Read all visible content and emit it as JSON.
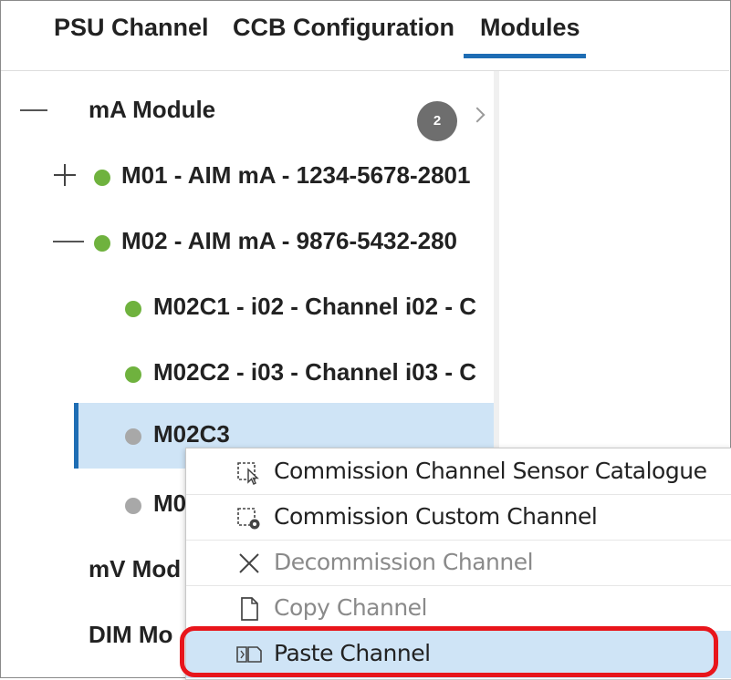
{
  "tabs": [
    {
      "label": "PSU Channel"
    },
    {
      "label": "CCB Configuration"
    },
    {
      "label": "Modules",
      "active": true
    }
  ],
  "tree": {
    "groups": {
      "ma_module": {
        "label": "mA Module",
        "badge": "2"
      },
      "mv_module": {
        "label": "mV Mod"
      },
      "dim_module": {
        "label": "DIM Mo"
      }
    },
    "modules": [
      {
        "label": "M01 - AIM mA - 1234-5678-2801",
        "status": "green",
        "expanded": false
      },
      {
        "label": "M02 - AIM mA - 9876-5432-280",
        "status": "green",
        "expanded": true
      }
    ],
    "channels": [
      {
        "label": "M02C1 - i02 - Channel i02 - C",
        "status": "green"
      },
      {
        "label": "M02C2 - i03 - Channel i03 - C",
        "status": "green"
      },
      {
        "label": "M02C3",
        "status": "gray",
        "selected": true
      },
      {
        "label": "M0",
        "status": "gray"
      }
    ]
  },
  "context_menu": {
    "items": [
      {
        "label": "Commission Channel Sensor Catalogue",
        "icon": "commission-catalogue-icon",
        "disabled": false
      },
      {
        "label": "Commission Custom Channel",
        "icon": "commission-custom-icon",
        "disabled": false
      },
      {
        "label": "Decommission Channel",
        "icon": "close-icon",
        "disabled": true
      },
      {
        "label": "Copy Channel",
        "icon": "document-icon",
        "disabled": true
      },
      {
        "label": "Paste Channel",
        "icon": "paste-icon",
        "disabled": false,
        "hovered": true
      }
    ]
  },
  "colors": {
    "accent": "#1e6db4",
    "status_green": "#6fb23e",
    "status_gray": "#a8a8a8",
    "selection_bg": "#cfe4f6",
    "highlight_border": "#e8151b"
  }
}
